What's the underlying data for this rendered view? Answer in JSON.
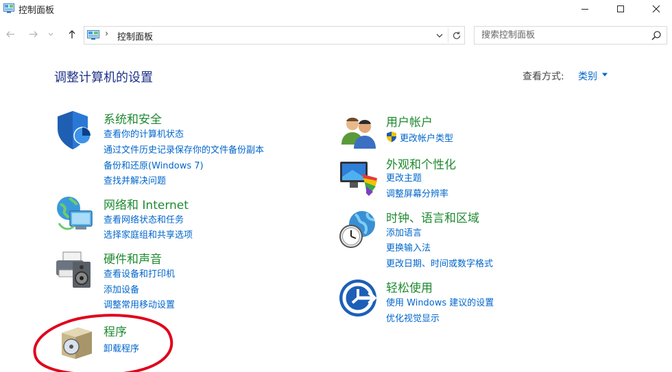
{
  "window": {
    "title": "控制面板"
  },
  "address": {
    "separator": "›",
    "path": "控制面板"
  },
  "search": {
    "placeholder": "搜索控制面板"
  },
  "main": {
    "heading": "调整计算机的设置",
    "view_by_label": "查看方式:",
    "view_by_value": "类别"
  },
  "categories": {
    "system_security": {
      "title": "系统和安全",
      "links": [
        "查看你的计算机状态",
        "通过文件历史记录保存你的文件备份副本",
        "备份和还原(Windows 7)",
        "查找并解决问题"
      ]
    },
    "network": {
      "title": "网络和 Internet",
      "links": [
        "查看网络状态和任务",
        "选择家庭组和共享选项"
      ]
    },
    "hardware": {
      "title": "硬件和声音",
      "links": [
        "查看设备和打印机",
        "添加设备",
        "调整常用移动设置"
      ]
    },
    "programs": {
      "title": "程序",
      "links": [
        "卸载程序"
      ]
    },
    "user_accounts": {
      "title": "用户帐户",
      "links": [
        "更改帐户类型"
      ]
    },
    "appearance": {
      "title": "外观和个性化",
      "links": [
        "更改主题",
        "调整屏幕分辨率"
      ]
    },
    "clock_region": {
      "title": "时钟、语言和区域",
      "links": [
        "添加语言",
        "更换输入法",
        "更改日期、时间或数字格式"
      ]
    },
    "ease_access": {
      "title": "轻松使用",
      "links": [
        "使用 Windows 建议的设置",
        "优化视觉显示"
      ]
    }
  },
  "colors": {
    "category_title": "#1e8a30",
    "link": "#0066cc",
    "heading": "#1e3287",
    "annotation": "#e0001b"
  }
}
